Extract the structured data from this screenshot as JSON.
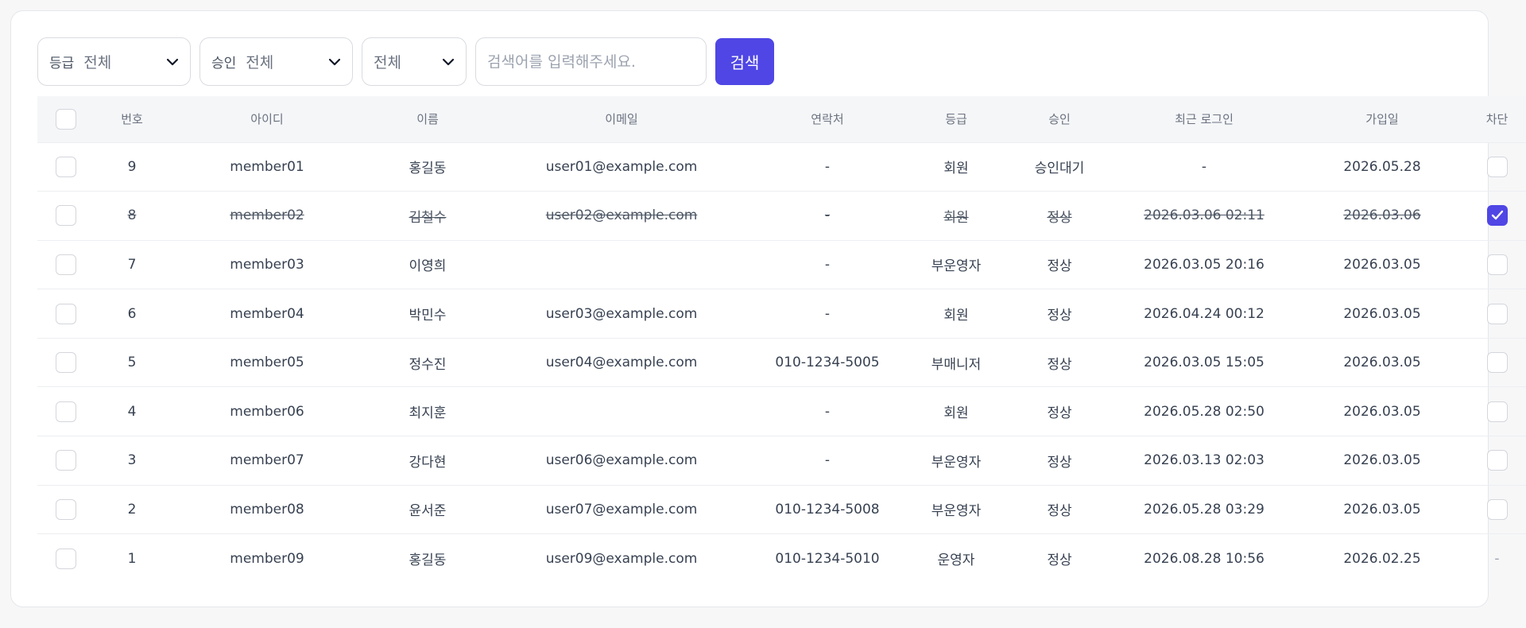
{
  "filters": {
    "grade": {
      "label": "등급",
      "value": "전체"
    },
    "approval": {
      "label": "승인",
      "value": "전체"
    },
    "status": {
      "value": "전체"
    },
    "search_placeholder": "검색어를 입력해주세요.",
    "search_button": "검색"
  },
  "table": {
    "headers": {
      "no": "번호",
      "id": "아이디",
      "name": "이름",
      "email": "이메일",
      "phone": "연락처",
      "grade": "등급",
      "approval": "승인",
      "last_login": "최근 로그인",
      "joined": "가입일",
      "block": "차단"
    },
    "rows": [
      {
        "no": "9",
        "id": "member01",
        "name": "홍길동",
        "email": "user01@example.com",
        "phone": "-",
        "grade": "회원",
        "approval": "승인대기",
        "last_login": "-",
        "joined": "2026.05.28",
        "blocked": false,
        "block_cell": "checkbox"
      },
      {
        "no": "8",
        "id": "member02",
        "name": "김철수",
        "email": "user02@example.com",
        "phone": "-",
        "grade": "회원",
        "approval": "정상",
        "last_login": "2026.03.06 02:11",
        "joined": "2026.03.06",
        "blocked": true,
        "block_cell": "checkbox"
      },
      {
        "no": "7",
        "id": "member03",
        "name": "이영희",
        "email": "",
        "phone": "-",
        "grade": "부운영자",
        "approval": "정상",
        "last_login": "2026.03.05 20:16",
        "joined": "2026.03.05",
        "blocked": false,
        "block_cell": "checkbox"
      },
      {
        "no": "6",
        "id": "member04",
        "name": "박민수",
        "email": "user03@example.com",
        "phone": "-",
        "grade": "회원",
        "approval": "정상",
        "last_login": "2026.04.24 00:12",
        "joined": "2026.03.05",
        "blocked": false,
        "block_cell": "checkbox"
      },
      {
        "no": "5",
        "id": "member05",
        "name": "정수진",
        "email": "user04@example.com",
        "phone": "010-1234-5005",
        "grade": "부매니저",
        "approval": "정상",
        "last_login": "2026.03.05 15:05",
        "joined": "2026.03.05",
        "blocked": false,
        "block_cell": "checkbox"
      },
      {
        "no": "4",
        "id": "member06",
        "name": "최지훈",
        "email": "",
        "phone": "-",
        "grade": "회원",
        "approval": "정상",
        "last_login": "2026.05.28 02:50",
        "joined": "2026.03.05",
        "blocked": false,
        "block_cell": "checkbox"
      },
      {
        "no": "3",
        "id": "member07",
        "name": "강다현",
        "email": "user06@example.com",
        "phone": "-",
        "grade": "부운영자",
        "approval": "정상",
        "last_login": "2026.03.13 02:03",
        "joined": "2026.03.05",
        "blocked": false,
        "block_cell": "checkbox"
      },
      {
        "no": "2",
        "id": "member08",
        "name": "윤서준",
        "email": "user07@example.com",
        "phone": "010-1234-5008",
        "grade": "부운영자",
        "approval": "정상",
        "last_login": "2026.05.28 03:29",
        "joined": "2026.03.05",
        "blocked": false,
        "block_cell": "checkbox"
      },
      {
        "no": "1",
        "id": "member09",
        "name": "홍길동",
        "email": "user09@example.com",
        "phone": "010-1234-5010",
        "grade": "운영자",
        "approval": "정상",
        "last_login": "2026.08.28 10:56",
        "joined": "2026.02.25",
        "blocked": false,
        "block_cell": "-"
      }
    ]
  },
  "colors": {
    "accent": "#4f46e5",
    "header_bg": "#f5f6f8",
    "border": "#e5e7eb"
  }
}
